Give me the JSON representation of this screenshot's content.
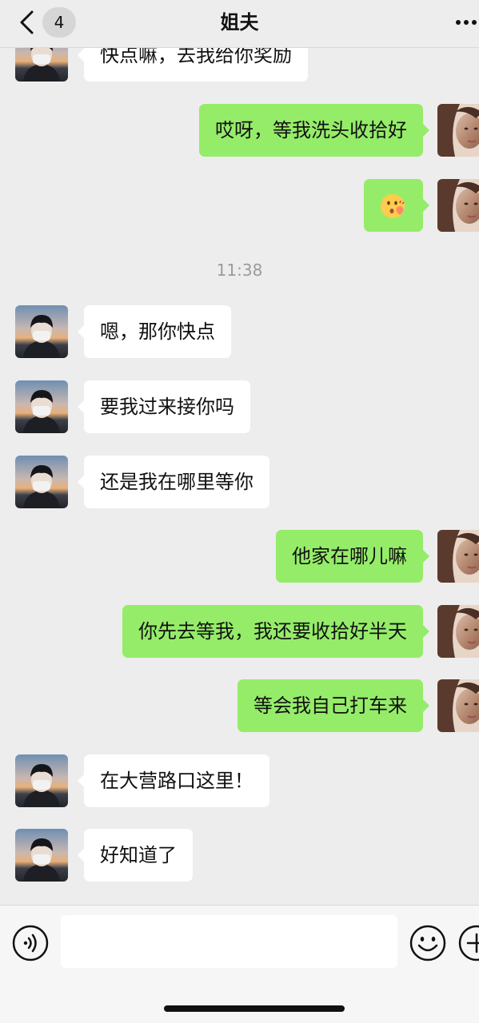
{
  "header": {
    "title": "姐夫",
    "unread_count": "4",
    "back_icon": "chevron-left-icon",
    "more_icon": "more-dots-icon"
  },
  "messages": [
    {
      "side": "left",
      "text": "快点嘛，去我给你奖励",
      "partial": true
    },
    {
      "side": "right",
      "text": "哎呀，等我洗头收拾好"
    },
    {
      "side": "right",
      "emoji": "blowing-kiss-emoji"
    },
    {
      "timestamp": "11:38"
    },
    {
      "side": "left",
      "text": "嗯，那你快点"
    },
    {
      "side": "left",
      "text": "要我过来接你吗"
    },
    {
      "side": "left",
      "text": "还是我在哪里等你"
    },
    {
      "side": "right",
      "text": "他家在哪儿嘛"
    },
    {
      "side": "right",
      "text": "你先去等我，我还要收拾好半天"
    },
    {
      "side": "right",
      "text": "等会我自己打车来"
    },
    {
      "side": "left",
      "text": "在大营路口这里！"
    },
    {
      "side": "left",
      "text": "好知道了"
    }
  ],
  "input_bar": {
    "voice_icon": "voice-icon",
    "emoji_icon": "emoji-icon",
    "plus_icon": "plus-icon",
    "input_value": ""
  },
  "colors": {
    "background": "#ededed",
    "sent_bubble": "#95ec69",
    "received_bubble": "#ffffff",
    "timestamp": "#9b9b9b"
  }
}
